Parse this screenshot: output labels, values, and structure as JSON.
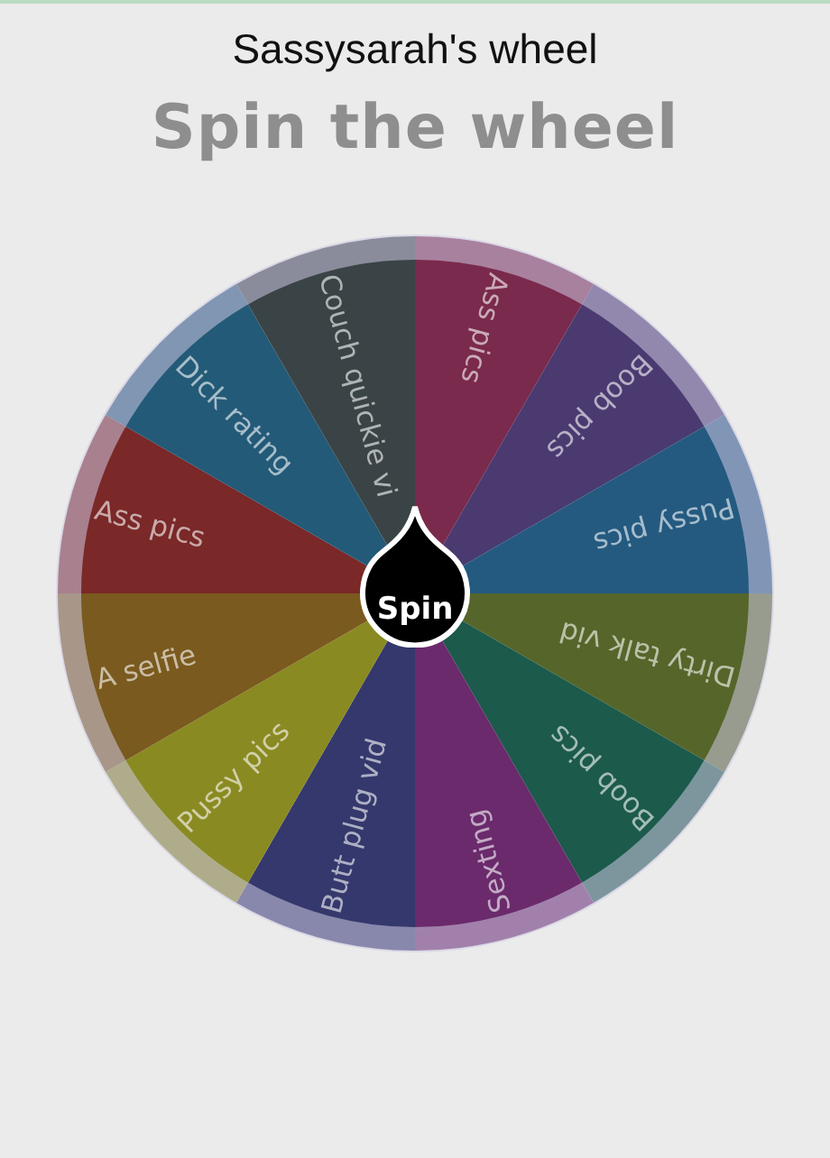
{
  "title": "Sassysarah's wheel",
  "heading": "Spin the wheel",
  "segments": [
    {
      "label": "Ass pics",
      "color": "#7a2a4c"
    },
    {
      "label": "Boob pics",
      "color": "#4a3a70"
    },
    {
      "label": "Pussy pics",
      "color": "#245a80"
    },
    {
      "label": "Dirty talk vid",
      "color": "#56662a"
    },
    {
      "label": "Boob pics",
      "color": "#1c5a4c"
    },
    {
      "label": "Sexting",
      "color": "#6a2a6c"
    },
    {
      "label": "Butt plug vid",
      "color": "#34386c"
    },
    {
      "label": "Pussy pics",
      "color": "#8a8a22"
    },
    {
      "label": "A selfie",
      "color": "#7a5a1e"
    },
    {
      "label": "Ass pics",
      "color": "#7a2828"
    },
    {
      "label": "Dick rating",
      "color": "#235a78"
    },
    {
      "label": "Couch quickie vi",
      "color": "#3a4446"
    }
  ],
  "spin_button": "Spin"
}
